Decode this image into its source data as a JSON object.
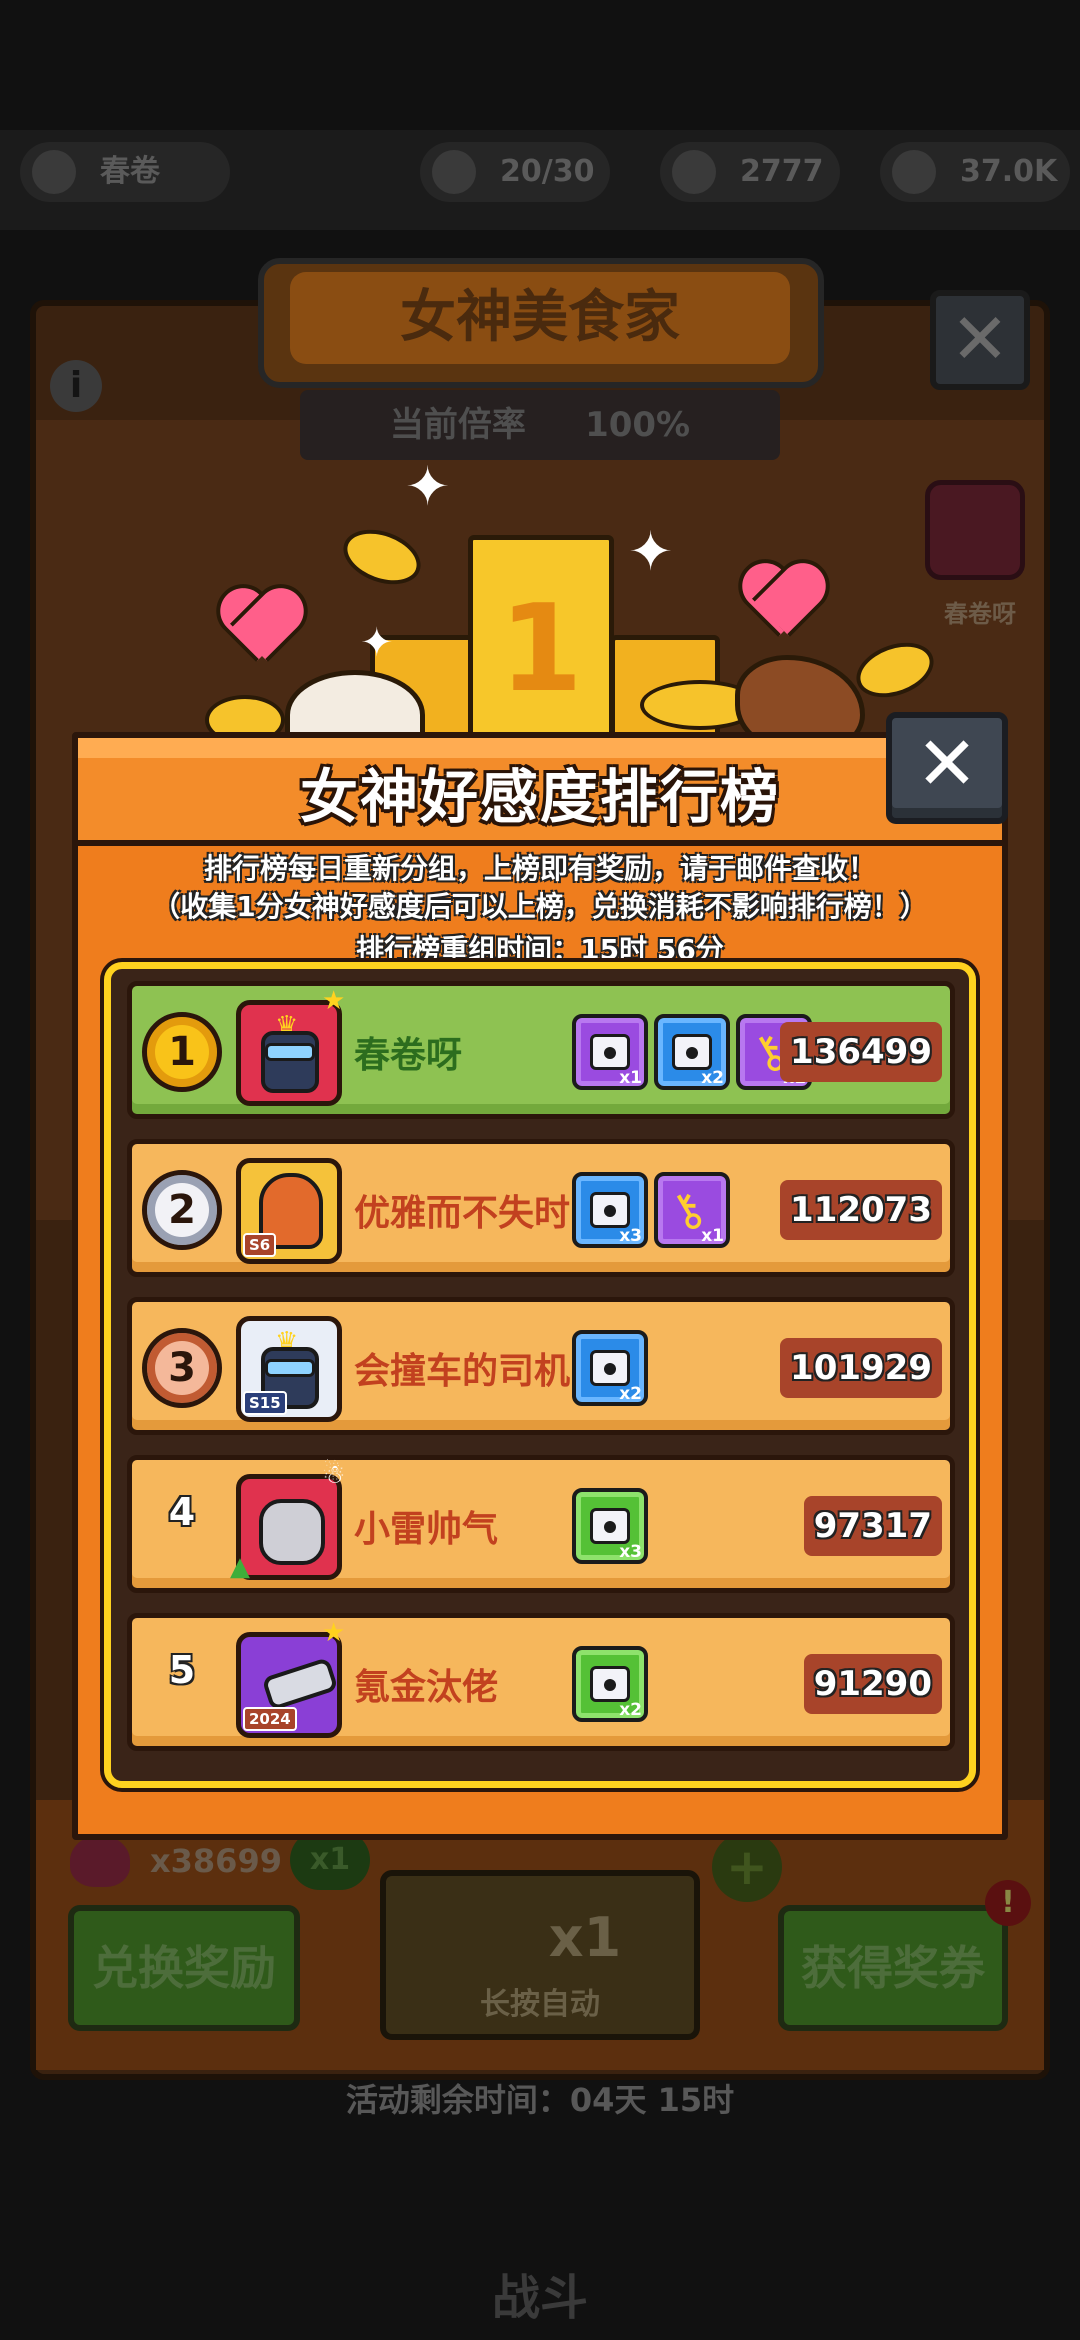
{
  "background": {
    "resources": [
      "春卷",
      "20/30",
      "2777",
      "37.0K"
    ],
    "event_title": "女神美食家",
    "rate_label": "当前倍率",
    "rate_value": "100%",
    "featured_player_name": "春卷呀",
    "heart_count": "x38699",
    "multiplier_pill": "x1",
    "exchange_button": "兑换奖励",
    "ticket_count": "x1",
    "long_press_label": "长按自动",
    "get_tickets_button": "获得奖券",
    "remaining_time": "活动剩余时间：04天 15时",
    "nav_label": "战斗",
    "podium_number": "1"
  },
  "popup": {
    "title": "女神好感度排行榜",
    "close_glyph": "✕",
    "info_line1": "排行榜每日重新分组，上榜即有奖励，请于邮件查收！",
    "info_line2": "（收集1分女神好感度后可以上榜，兑换消耗不影响排行榜！）",
    "regroup_time": "排行榜重组时间：15时 56分"
  },
  "leaderboard": [
    {
      "rank": "1",
      "name": "春卷呀",
      "score": "136499",
      "avatar_badge": "",
      "rewards": [
        {
          "type": "purple-chest",
          "count": "x1"
        },
        {
          "type": "blue-chest",
          "count": "x2"
        },
        {
          "type": "purple-key",
          "count": "x1"
        }
      ]
    },
    {
      "rank": "2",
      "name": "优雅而不失时",
      "score": "112073",
      "avatar_badge": "S6",
      "rewards": [
        {
          "type": "blue-chest",
          "count": "x3"
        },
        {
          "type": "purple-key",
          "count": "x1"
        }
      ]
    },
    {
      "rank": "3",
      "name": "会撞车的司机",
      "score": "101929",
      "avatar_badge": "S15",
      "rewards": [
        {
          "type": "blue-chest",
          "count": "x2"
        }
      ]
    },
    {
      "rank": "4",
      "name": "小雷帅气",
      "score": "97317",
      "avatar_badge": "",
      "rewards": [
        {
          "type": "green-chest",
          "count": "x3"
        }
      ]
    },
    {
      "rank": "5",
      "name": "氪金汰佬",
      "score": "91290",
      "avatar_badge": "2024",
      "rewards": [
        {
          "type": "green-chest",
          "count": "x2"
        }
      ]
    }
  ],
  "colors": {
    "popup_orange": "#ef7d1d",
    "list_border_yellow": "#ffd21f",
    "first_row_green": "#8ec252",
    "other_row_tan": "#f6b75c",
    "score_pill": "#a8442a"
  }
}
